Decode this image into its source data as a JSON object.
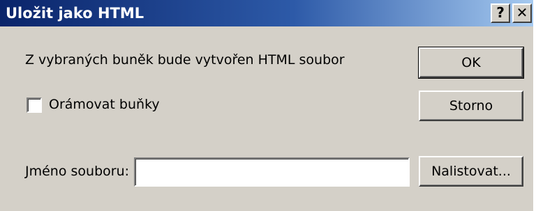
{
  "dialog": {
    "title": "Uložit jako HTML",
    "help_glyph": "?",
    "close_glyph": "✕",
    "message": "Z vybraných buněk bude vytvořen HTML soubor",
    "checkbox_label": "Orámovat buňky",
    "checkbox_checked": false,
    "filename_label": "Jméno souboru:",
    "filename_value": "",
    "ok_label": "OK",
    "cancel_label": "Storno",
    "browse_label": "Nalistovat..."
  },
  "colors": {
    "title_start": "#0a246a",
    "title_end": "#a6caf0",
    "face": "#d4d0c8"
  }
}
